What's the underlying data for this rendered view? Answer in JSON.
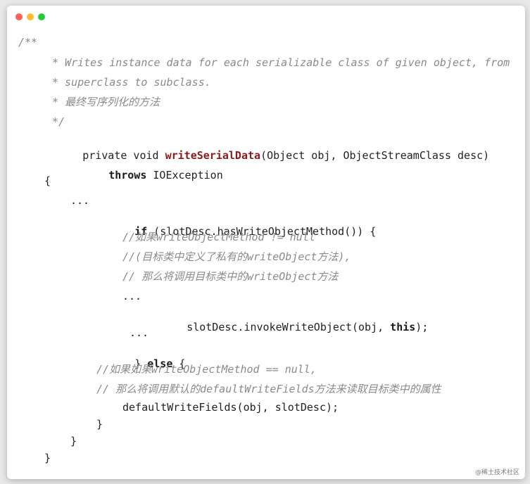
{
  "window": {
    "controls": {
      "close_color": "#fe5f57",
      "minimize_color": "#febc2e",
      "maximize_color": "#28c840"
    }
  },
  "code": {
    "lines": [
      {
        "text": "/**"
      },
      {
        "text": "* Writes instance data for each serializable class of given object, from"
      },
      {
        "text": "* superclass to subclass."
      },
      {
        "text": "* 最终写序列化的方法"
      },
      {
        "text": "*/"
      },
      {
        "t1": "private void ",
        "m": "writeSerialData",
        "t2": "(Object obj, ObjectStreamClass desc)"
      },
      {
        "k": "throws",
        "t": " IOException"
      },
      {
        "text": "{"
      },
      {
        "text": "..."
      },
      {
        "k": "if",
        "t": " (slotDesc.hasWriteObjectMethod()) {"
      },
      {
        "text": "//如果writeObjectMethod != null"
      },
      {
        "text": "//(目标类中定义了私有的writeObject方法),"
      },
      {
        "text": "// 那么将调用目标类中的writeObject方法"
      },
      {
        "text": "..."
      },
      {
        "t1": "slotDesc.invokeWriteObject(obj, ",
        "k": "this",
        "t2": ");"
      },
      {
        "text": "..."
      },
      {
        "t1": "} ",
        "k": "else",
        "t2": " {"
      },
      {
        "text": "//如果如果writeObjectMethod == null,"
      },
      {
        "text": "// 那么将调用默认的defaultWriteFields方法来读取目标类中的属性"
      },
      {
        "text": "defaultWriteFields(obj, slotDesc);"
      },
      {
        "text": "}"
      },
      {
        "text": "}"
      },
      {
        "text": "}"
      }
    ]
  },
  "watermark": "@稀土技术社区"
}
